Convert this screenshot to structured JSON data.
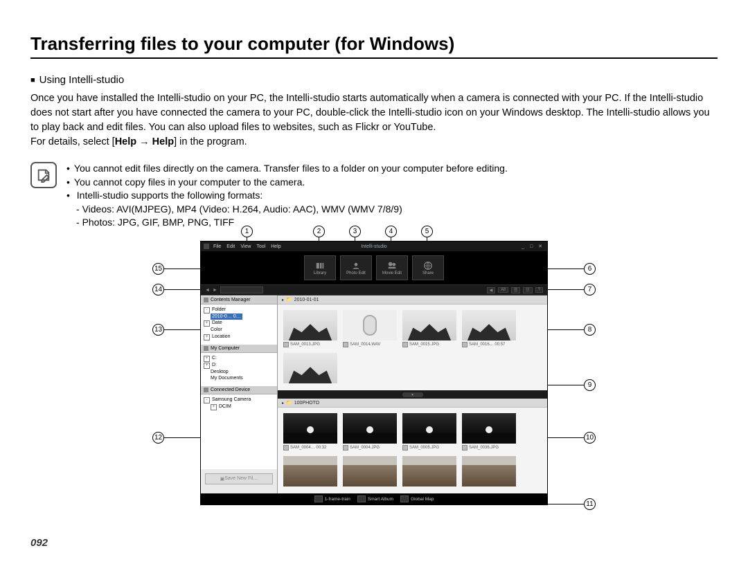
{
  "title": "Transferring files to your computer (for Windows)",
  "subhead": "Using Intelli-studio",
  "para1": "Once you have installed the Intelli-studio on your PC, the Intelli-studio starts automatically when a camera is connected with your PC. If the Intelli-studio does not start after you have connected the camera to your PC, double-click the Intelli-studio icon on your Windows desktop. The Intelli-studio allows you to play back and edit files. You can also upload files to websites, such as Flickr or YouTube.",
  "para2_pre": "For details, select [",
  "para2_b1": "Help",
  "para2_arrow": " → ",
  "para2_b2": "Help",
  "para2_post": "] in the program.",
  "notes": {
    "n1": "You cannot edit files directly on the camera. Transfer files to a folder on your computer before editing.",
    "n2": "You cannot copy files in your computer to the camera.",
    "n3": "Intelli-studio supports the following formats:",
    "n3a": "Videos: AVI(MJPEG), MP4 (Video: H.264, Audio: AAC), WMV (WMV 7/8/9)",
    "n3b": "Photos: JPG, GIF, BMP, PNG, TIFF"
  },
  "page_number": "092",
  "app": {
    "brand": "Intelli-studio",
    "menus": [
      "File",
      "Edit",
      "View",
      "Tool",
      "Help"
    ],
    "window_buttons": "_  □  ✕",
    "modes": [
      "Library",
      "Photo Edit",
      "Movie Edit",
      "Share"
    ],
    "toolbar_right": [
      "◀",
      "All",
      "☰",
      "☷",
      "?"
    ],
    "sidebar": {
      "contents_hdr": "Contents Manager",
      "tree": {
        "folder": "Folder",
        "sel": "2010-0… 0…",
        "date": "Date",
        "color": "Color",
        "location": "Location"
      },
      "mycomp_hdr": "My Computer",
      "mycomp": [
        "C:",
        "D:",
        "Desktop",
        "My Documents"
      ],
      "device_hdr": "Connected Device",
      "device": {
        "cam": "Samsung Camera",
        "dcim": "DCIM"
      },
      "new_btn": "Save New Fil…"
    },
    "group1": {
      "hdr": "2010-01-01",
      "thumbs": [
        "SAM_0013.JPG",
        "SAM_0014.WAV",
        "SAM_0015.JPG",
        "SAM_0016…  00:57"
      ]
    },
    "group2": {
      "hdr": "100PHOTO",
      "row1": [
        "SAM_0004…  00:32",
        "SAM_0004.JPG",
        "SAM_0005.JPG",
        "SAM_0036.JPG"
      ]
    },
    "bottom": [
      "1-frame-train",
      "Smart Album",
      "Global Map"
    ]
  },
  "callouts": {
    "c1": "1",
    "c2": "2",
    "c3": "3",
    "c4": "4",
    "c5": "5",
    "c6": "6",
    "c7": "7",
    "c8": "8",
    "c9": "9",
    "c10": "10",
    "c11": "11",
    "c12": "12",
    "c13": "13",
    "c14": "14",
    "c15": "15"
  }
}
